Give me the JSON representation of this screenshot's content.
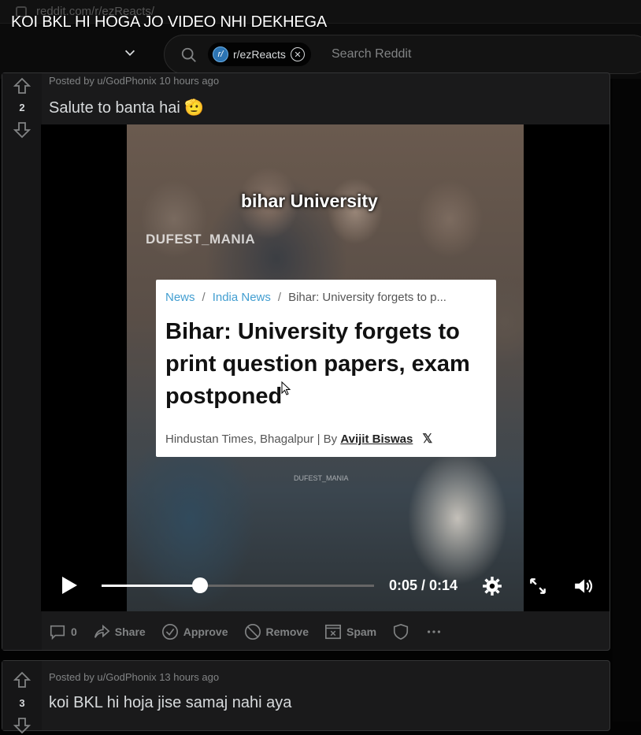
{
  "browser": {
    "url": "reddit.com/r/ezReacts/"
  },
  "overlay_title": "KOI BKL HI HOGA JO VIDEO NHI DEKHEGA",
  "search": {
    "chip_label": "r/ezReacts",
    "placeholder": "Search Reddit"
  },
  "posts": [
    {
      "meta": "Posted by u/GodPhonix 10 hours ago",
      "score": "2",
      "title": "Salute to banta hai 🫡",
      "video": {
        "overlay_text": "bihar University",
        "watermark": "DUFEST_MANIA",
        "watermark_small": "DUFEST_MANIA",
        "article": {
          "crumb_1": "News",
          "crumb_2": "India News",
          "crumb_3": "Bihar: University forgets to p...",
          "headline": "Bihar: University forgets to print question papers, exam postponed",
          "byline_source": "Hindustan Times, Bhagalpur | By ",
          "byline_author": "Avijit Biswas",
          "byline_x": "𝕏"
        },
        "time_text": "0:05 / 0:14",
        "progress": 0.36
      },
      "actions": {
        "comments_count": "0",
        "share": "Share",
        "approve": "Approve",
        "remove": "Remove",
        "spam": "Spam"
      }
    },
    {
      "meta": "Posted by u/GodPhonix 13 hours ago",
      "score": "3",
      "title": "koi BKL hi hoja jise samaj nahi aya"
    }
  ],
  "icons": [
    "search-icon",
    "chevron-down-icon",
    "close-icon",
    "upvote-icon",
    "downvote-icon",
    "play-icon",
    "settings-icon",
    "fullscreen-icon",
    "volume-icon",
    "comment-icon",
    "share-icon",
    "approve-icon",
    "remove-icon",
    "spam-icon",
    "shield-icon",
    "more-icon"
  ],
  "colors": {
    "page_bg": "#030303",
    "card_bg": "#1a1a1b",
    "link_blue": "#3aa0d8",
    "muted": "#818384"
  }
}
